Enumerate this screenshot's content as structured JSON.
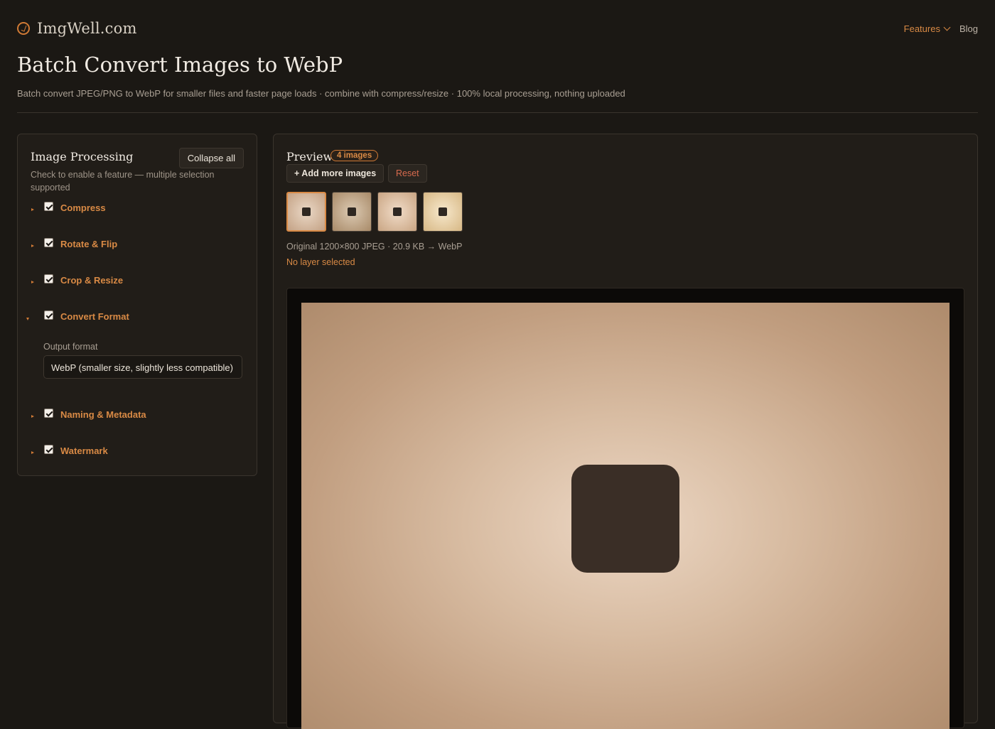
{
  "brand": {
    "name": "ImgWell.com",
    "icon": "target-logo-icon"
  },
  "nav": {
    "features": "Features",
    "blog": "Blog"
  },
  "page": {
    "title": "Batch Convert Images to WebP",
    "subtitle": "Batch convert JPEG/PNG to WebP for smaller files and faster page loads · combine with compress/resize · 100% local processing, nothing uploaded"
  },
  "processing": {
    "title": "Image Processing",
    "collapse_label": "Collapse all",
    "help": "Check to enable a feature — multiple selection supported",
    "features": [
      {
        "label": "Compress",
        "checked": true,
        "expanded": false
      },
      {
        "label": "Rotate & Flip",
        "checked": true,
        "expanded": false
      },
      {
        "label": "Crop & Resize",
        "checked": true,
        "expanded": false
      },
      {
        "label": "Convert Format",
        "checked": true,
        "expanded": true
      },
      {
        "label": "Naming & Metadata",
        "checked": true,
        "expanded": false
      },
      {
        "label": "Watermark",
        "checked": true,
        "expanded": false
      }
    ],
    "output_format": {
      "label": "Output format",
      "value": "WebP (smaller size, slightly less compatible)"
    }
  },
  "preview": {
    "title": "Preview",
    "badge": "4 images",
    "add_label": "+ Add more images",
    "reset_label": "Reset",
    "info": "Original 1200×800 JPEG · 20.9 KB → WebP",
    "layer_status": "No layer selected",
    "selected_thumb": 1,
    "thumb_count": 4
  },
  "colors": {
    "accent": "#d98a45",
    "danger": "#d86b4e",
    "background": "#1b1814",
    "panel": "#211d18"
  }
}
